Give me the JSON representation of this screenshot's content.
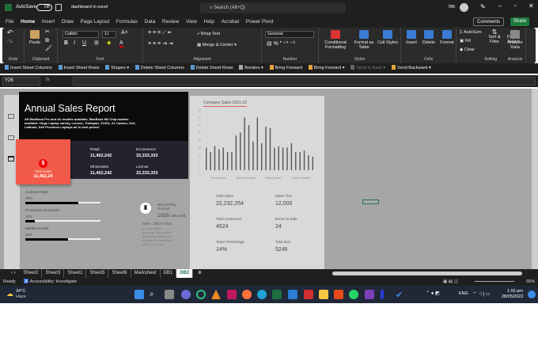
{
  "titlebar": {
    "autosave": "AutoSave",
    "toggle": "Off",
    "filename": "dashboard in excel",
    "search": "Search (Alt+Q)",
    "user": "786"
  },
  "menu": {
    "tabs": [
      "File",
      "Home",
      "Insert",
      "Draw",
      "Page Layout",
      "Formulas",
      "Data",
      "Review",
      "View",
      "Help",
      "Acrobat",
      "Power Pivot"
    ],
    "active": "Home",
    "comments": "Comments",
    "share": "Share"
  },
  "ribbon": {
    "groups": {
      "undo": "Undo",
      "clipboard": "Clipboard",
      "font": "Font",
      "alignment": "Alignment",
      "number": "Number",
      "styles": "Styles",
      "cells": "Cells",
      "editing": "Editing",
      "analysis": "Analysis"
    },
    "paste": "Paste",
    "font_name": "Calibri",
    "font_size": "11",
    "wrap": "Wrap Text",
    "merge": "Merge & Center",
    "number_format": "General",
    "conditional": "Conditional Formatting",
    "format_table": "Format as Table",
    "cell_styles": "Cell Styles",
    "insert": "Insert",
    "delete": "Delete",
    "format": "Format",
    "autosum": "AutoSum",
    "fill": "Fill",
    "clear": "Clear",
    "sort": "Sort & Filter",
    "find": "Find & Select",
    "analyze": "Analyze Data"
  },
  "qat": [
    "Insert Sheet Columns",
    "Insert Sheet Rows",
    "Shapes",
    "Delete Sheet Columns",
    "Delete Sheet Rows",
    "Borders",
    "Bring Forward",
    "Bring Forward",
    "Send to Back",
    "Send Backward"
  ],
  "formula": {
    "namebox": "Y26",
    "fx": "fx",
    "value": ""
  },
  "dashboard": {
    "title": "Annual Sales Report",
    "subtitle": "All MacBook Pro and Air models available, MacBook M2 Chip models available. Huge Laptop variety, Lenovo, Thinkpad, YOGA, X1 Carbon, Dell, Latitude, Dell Precision Laptops all in best prices!",
    "total_label": "Total Sales",
    "total_value": "11,452,24",
    "stats": [
      {
        "label": "Retail",
        "value": "11,452,242"
      },
      {
        "label": "ECommerce",
        "value": "33,333,333"
      },
      {
        "label": "Wholesales",
        "value": "11,452,242"
      },
      {
        "label": "License",
        "value": "33,333,333"
      }
    ],
    "progress": [
      {
        "label": "Custome Rate",
        "pct_label": "70%",
        "value": 0.7
      },
      {
        "label": "Production Increased",
        "pct_label": "11%",
        "value": 0.13
      },
      {
        "label": "Market Growth",
        "pct_label": "60%",
        "value": 0.57
      }
    ],
    "best": {
      "label": "Best Selling Product",
      "units": "1059",
      "units_suffix": "units sold",
      "name": "SMA · Office Chair",
      "desc": "A comfortable armchair that allows the person sitting in it to relax the back and lift up a footrest"
    },
    "kpis": [
      {
        "label": "Total Sales",
        "value": "22,232,254"
      },
      {
        "label": "Sales This",
        "value": "12,000"
      },
      {
        "label": "Total Customers",
        "value": "4524"
      },
      {
        "label": "Items on Sale",
        "value": "24"
      },
      {
        "label": "Taxes Percentage",
        "value": "14%"
      },
      {
        "label": "Total Item",
        "value": "5246"
      }
    ]
  },
  "chart_data": {
    "type": "bar",
    "title": "Company Sales 2021-22",
    "categories": [
      "First Quarter",
      "Second Quarter",
      "Third Quarter",
      "Fourth Quarter"
    ],
    "values": [
      15,
      12,
      16,
      14,
      15,
      12,
      12,
      23,
      25,
      35,
      30,
      19,
      35,
      18,
      29,
      28,
      15,
      16,
      15,
      15,
      18,
      12,
      12,
      13,
      10,
      9
    ],
    "yticks": [
      "0",
      "5",
      "10",
      "15",
      "20",
      "25",
      "30",
      "35",
      "40"
    ],
    "ylim": [
      0,
      40
    ],
    "xlabel": "",
    "ylabel": ""
  },
  "sheets": {
    "tabs": [
      "Sheet2",
      "Sheet3",
      "Sheet1",
      "Sheet5",
      "Sheet6",
      "Marksheet",
      "DB1",
      "DB2"
    ],
    "active": "DB2"
  },
  "status": {
    "ready": "Ready",
    "accessibility": "Accessibility: Investigate",
    "zoom": "65%"
  },
  "taskbar": {
    "temp": "34°C",
    "weather": "Haze",
    "lang": "ENG",
    "time": "1:55 pm",
    "date": "28/05/2022"
  }
}
